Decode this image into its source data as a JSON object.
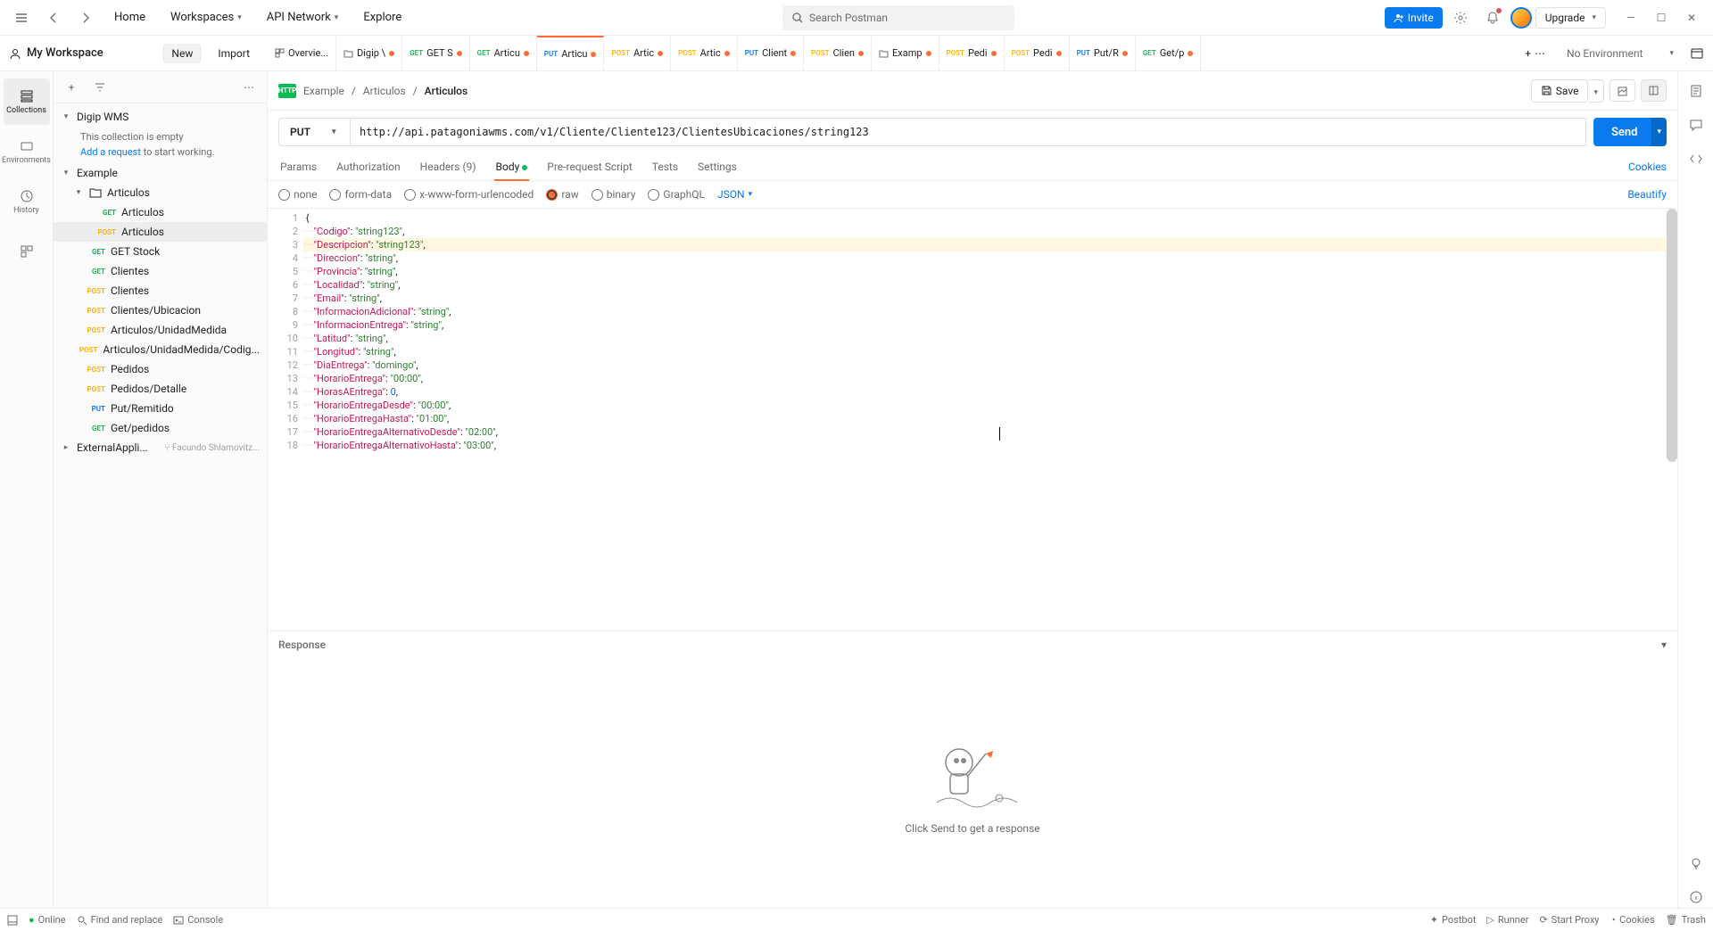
{
  "topnav": {
    "home": "Home",
    "workspaces": "Workspaces",
    "api_network": "API Network",
    "explore": "Explore",
    "search_placeholder": "Search Postman",
    "invite": "Invite",
    "upgrade": "Upgrade"
  },
  "wsbar": {
    "workspace": "My Workspace",
    "new": "New",
    "import": "Import",
    "env": "No Environment"
  },
  "tabs": [
    {
      "icon": "overview",
      "label": "Overvie..."
    },
    {
      "icon": "folder",
      "label": "Digip \\",
      "dot": true
    },
    {
      "method": "GET",
      "mclass": "m-get",
      "label": "GET S",
      "dot": true
    },
    {
      "method": "GET",
      "mclass": "m-get",
      "label": "Articu",
      "dot": true
    },
    {
      "method": "PUT",
      "mclass": "m-put",
      "label": "Articu",
      "dot": true,
      "active": true
    },
    {
      "method": "POST",
      "mclass": "m-post",
      "label": "Artic",
      "dot": true
    },
    {
      "method": "POST",
      "mclass": "m-post",
      "label": "Artic",
      "dot": true
    },
    {
      "method": "PUT",
      "mclass": "m-put",
      "label": "Client",
      "dot": true
    },
    {
      "method": "POST",
      "mclass": "m-post",
      "label": "Clien",
      "dot": true
    },
    {
      "icon": "folder",
      "label": "Examp",
      "dot": true
    },
    {
      "method": "POST",
      "mclass": "m-post",
      "label": "Pedi",
      "dot": true
    },
    {
      "method": "POST",
      "mclass": "m-post",
      "label": "Pedi",
      "dot": true
    },
    {
      "method": "PUT",
      "mclass": "m-put",
      "label": "Put/R",
      "dot": true
    },
    {
      "method": "GET",
      "mclass": "m-get",
      "label": "Get/p",
      "dot": true
    }
  ],
  "side_icons": [
    {
      "name": "collections",
      "label": "Collections",
      "active": true
    },
    {
      "name": "environments",
      "label": "Environments"
    },
    {
      "name": "history",
      "label": "History"
    },
    {
      "name": "more",
      "label": ""
    }
  ],
  "tree": {
    "root1": {
      "name": "Digip WMS",
      "empty_text": "This collection is empty",
      "add_link": "Add a request",
      "add_suffix": " to start working."
    },
    "root2": {
      "name": "Example"
    },
    "folder": {
      "name": "Articulos"
    },
    "items": [
      {
        "method": "GET",
        "mclass": "m-get",
        "name": "Articulos"
      },
      {
        "method": "POST",
        "mclass": "m-post",
        "name": "Articulos",
        "selected": true
      },
      {
        "method": "GET",
        "mclass": "m-get",
        "name": "GET Stock"
      },
      {
        "method": "GET",
        "mclass": "m-get",
        "name": "Clientes"
      },
      {
        "method": "POST",
        "mclass": "m-post",
        "name": "Clientes"
      },
      {
        "method": "POST",
        "mclass": "m-post",
        "name": "Clientes/Ubicacion"
      },
      {
        "method": "POST",
        "mclass": "m-post",
        "name": "Articulos/UnidadMedida"
      },
      {
        "method": "POST",
        "mclass": "m-post",
        "name": "Articulos/UnidadMedida/Codig..."
      },
      {
        "method": "POST",
        "mclass": "m-post",
        "name": "Pedidos"
      },
      {
        "method": "POST",
        "mclass": "m-post",
        "name": "Pedidos/Detalle"
      },
      {
        "method": "PUT",
        "mclass": "m-put",
        "name": "Put/Remitido"
      },
      {
        "method": "GET",
        "mclass": "m-get",
        "name": "Get/pedidos"
      }
    ],
    "root3": {
      "name": "ExternalAppli...",
      "fork": "Facundo Shlamovitz..."
    }
  },
  "breadcrumb": {
    "icon": "HTTP",
    "p1": "Example",
    "p2": "Articulos",
    "p3": "Articulos",
    "save": "Save"
  },
  "request": {
    "method": "PUT",
    "url": "http://api.patagoniawms.com/v1/Cliente/Cliente123/ClientesUbicaciones/string123",
    "send": "Send"
  },
  "req_tabs": {
    "params": "Params",
    "auth": "Authorization",
    "headers": "Headers (9)",
    "body": "Body",
    "pre": "Pre-request Script",
    "tests": "Tests",
    "settings": "Settings",
    "cookies": "Cookies"
  },
  "body_types": {
    "none": "none",
    "form": "form-data",
    "url": "x-www-form-urlencoded",
    "raw": "raw",
    "binary": "binary",
    "graphql": "GraphQL",
    "json": "JSON",
    "beautify": "Beautify"
  },
  "code_lines": [
    {
      "n": 1,
      "raw": "{"
    },
    {
      "n": 2,
      "k": "Codigo",
      "v": "\"string123\"",
      "t": "str",
      "c": true
    },
    {
      "n": 3,
      "k": "Descripcion",
      "v": "\"string123\"",
      "t": "str",
      "c": true,
      "hl": true
    },
    {
      "n": 4,
      "k": "Direccion",
      "v": "\"string\"",
      "t": "str",
      "c": true
    },
    {
      "n": 5,
      "k": "Provincia",
      "v": "\"string\"",
      "t": "str",
      "c": true
    },
    {
      "n": 6,
      "k": "Localidad",
      "v": "\"string\"",
      "t": "str",
      "c": true
    },
    {
      "n": 7,
      "k": "Email",
      "v": "\"string\"",
      "t": "str",
      "c": true
    },
    {
      "n": 8,
      "k": "InformacionAdicional",
      "v": "\"string\"",
      "t": "str",
      "c": true
    },
    {
      "n": 9,
      "k": "InformacionEntrega",
      "v": "\"string\"",
      "t": "str",
      "c": true
    },
    {
      "n": 10,
      "k": "Latitud",
      "v": "\"string\"",
      "t": "str",
      "c": true
    },
    {
      "n": 11,
      "k": "Longitud",
      "v": "\"string\"",
      "t": "str",
      "c": true
    },
    {
      "n": 12,
      "k": "DiaEntrega",
      "v": "\"domingo\"",
      "t": "str",
      "c": true
    },
    {
      "n": 13,
      "k": "HorarioEntrega",
      "v": "\"00:00\"",
      "t": "str",
      "c": true
    },
    {
      "n": 14,
      "k": "HorasAEntrega",
      "v": "0",
      "t": "num",
      "c": true
    },
    {
      "n": 15,
      "k": "HorarioEntregaDesde",
      "v": "\"00:00\"",
      "t": "str",
      "c": true
    },
    {
      "n": 16,
      "k": "HorarioEntregaHasta",
      "v": "\"01:00\"",
      "t": "str",
      "c": true
    },
    {
      "n": 17,
      "k": "HorarioEntregaAlternativoDesde",
      "v": "\"02:00\"",
      "t": "str",
      "c": true
    },
    {
      "n": 18,
      "k": "HorarioEntregaAlternativoHasta",
      "v": "\"03:00\"",
      "t": "str",
      "c": true
    }
  ],
  "response": {
    "title": "Response",
    "hint": "Click Send to get a response"
  },
  "statusbar": {
    "online": "Online",
    "find": "Find and replace",
    "console": "Console",
    "postbot": "Postbot",
    "runner": "Runner",
    "proxy": "Start Proxy",
    "cookies": "Cookies",
    "trash": "Trash"
  }
}
